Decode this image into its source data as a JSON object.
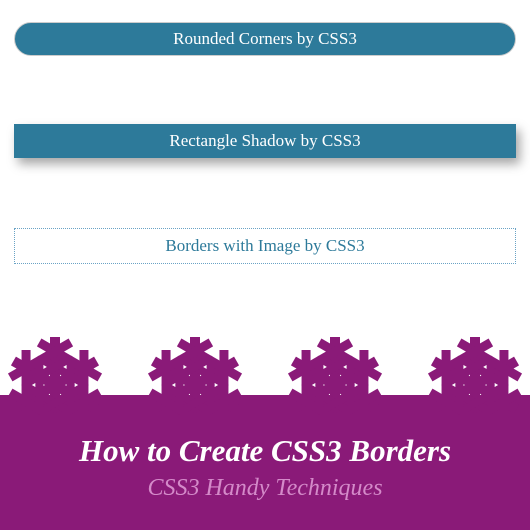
{
  "demos": {
    "rounded_label": "Rounded Corners by CSS3",
    "shadow_label": "Rectangle Shadow by CSS3",
    "image_border_label": "Borders with Image by CSS3"
  },
  "footer": {
    "title": "How to Create CSS3 Borders",
    "subtitle": "CSS3 Handy Techniques"
  },
  "colors": {
    "box_bg": "#2d7a9a",
    "accent": "#8a1a78",
    "sub_text": "#d48ac9"
  }
}
